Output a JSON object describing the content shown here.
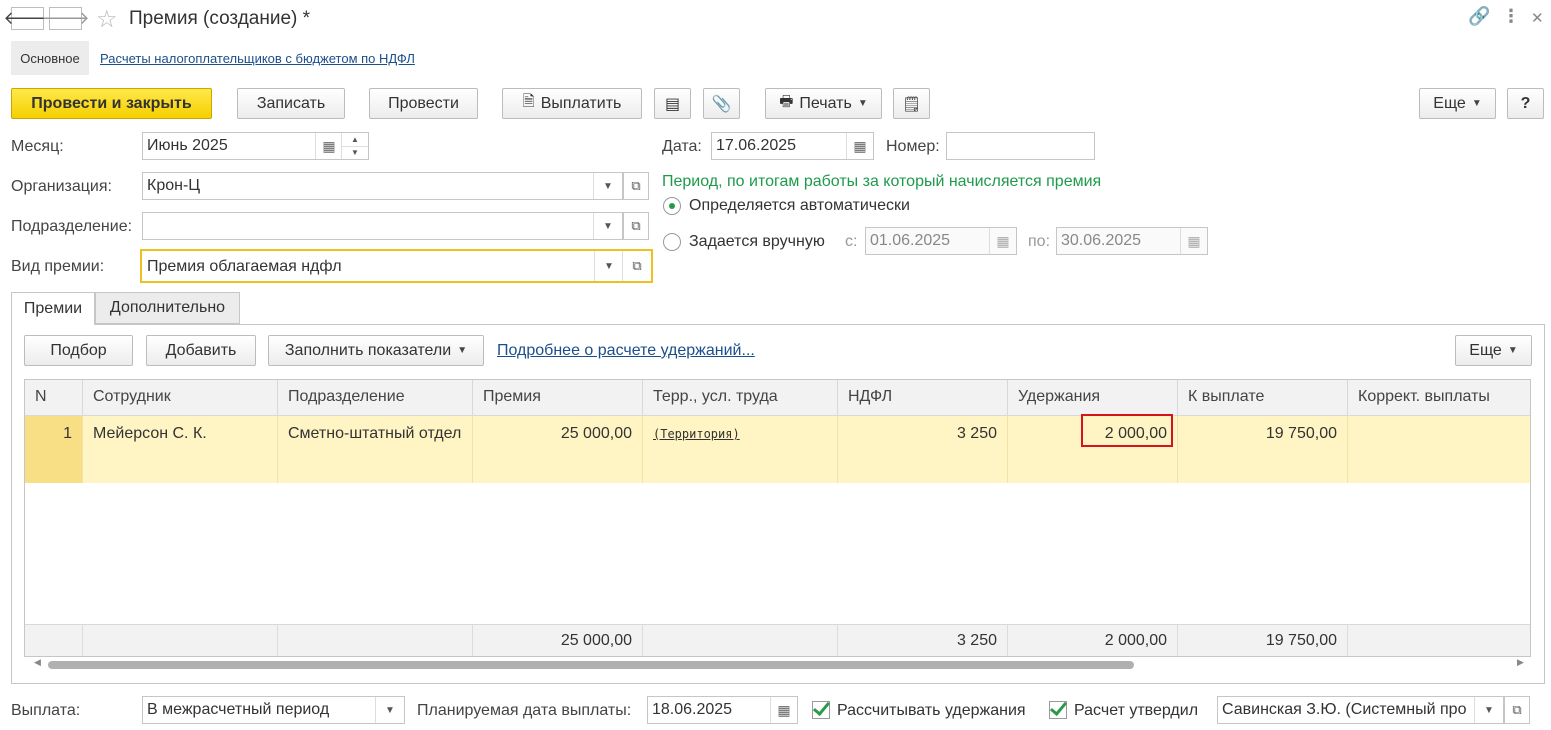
{
  "window": {
    "title": "Премия (создание) *",
    "back_icon": "arrow-left-icon",
    "forward_icon": "arrow-right-icon",
    "star_icon": "star-icon",
    "link_icon": "link-icon",
    "more_icon": "kebab-icon",
    "close_icon": "close-icon"
  },
  "sections": {
    "main": "Основное",
    "link": "Расчеты налогоплательщиков с бюджетом по НДФЛ"
  },
  "toolbar": {
    "post_close": "Провести и закрыть",
    "save": "Записать",
    "post": "Провести",
    "pay": "Выплатить",
    "print": "Печать",
    "more": "Еще",
    "help": "?"
  },
  "form": {
    "month_label": "Месяц:",
    "month_value": "Июнь 2025",
    "org_label": "Организация:",
    "org_value": "Крон-Ц",
    "dept_label": "Подразделение:",
    "dept_value": "",
    "bonus_type_label": "Вид премии:",
    "bonus_type_value": "Премия облагаемая ндфл",
    "date_label": "Дата:",
    "date_value": "17.06.2025",
    "number_label": "Номер:",
    "number_value": "",
    "period_heading": "Период, по итогам работы за который начисляется премия",
    "auto_label": "Определяется автоматически",
    "manual_label": "Задается вручную",
    "from_label": "с:",
    "from_value": "01.06.2025",
    "to_label": "по:",
    "to_value": "30.06.2025"
  },
  "tabs": {
    "bonuses": "Премии",
    "additional": "Дополнительно"
  },
  "table_toolbar": {
    "select": "Подбор",
    "add": "Добавить",
    "fill": "Заполнить показатели",
    "details_link": "Подробнее о расчете удержаний...",
    "more": "Еще"
  },
  "table": {
    "columns": [
      "N",
      "Сотрудник",
      "Подразделение",
      "Премия",
      "Терр., усл. труда",
      "НДФЛ",
      "Удержания",
      "К выплате",
      "Коррект. выплаты"
    ],
    "rows": [
      {
        "n": "1",
        "employee": "Мейерсон С. К.",
        "dept": "Сметно-штатный отдел",
        "bonus": "25 000,00",
        "territory": "(Территория)",
        "ndfl": "3 250",
        "deductions": "2 000,00",
        "to_pay": "19 750,00",
        "correction": ""
      }
    ],
    "totals": {
      "bonus": "25 000,00",
      "ndfl": "3 250",
      "deductions": "2 000,00",
      "to_pay": "19 750,00"
    }
  },
  "footer": {
    "payment_label": "Выплата:",
    "payment_value": "В межрасчетный период",
    "planned_date_label": "Планируемая дата выплаты:",
    "planned_date_value": "18.06.2025",
    "calc_deductions_label": "Рассчитывать удержания",
    "approved_label": "Расчет утвердил",
    "approver_value": "Савинская З.Ю. (Системный про"
  },
  "colors": {
    "accent_yellow": "#f5cf00",
    "link_blue": "#1a4f8b",
    "green": "#1e9a4b",
    "row_highlight": "#fff5c4",
    "highlight_red": "#d4141c"
  }
}
